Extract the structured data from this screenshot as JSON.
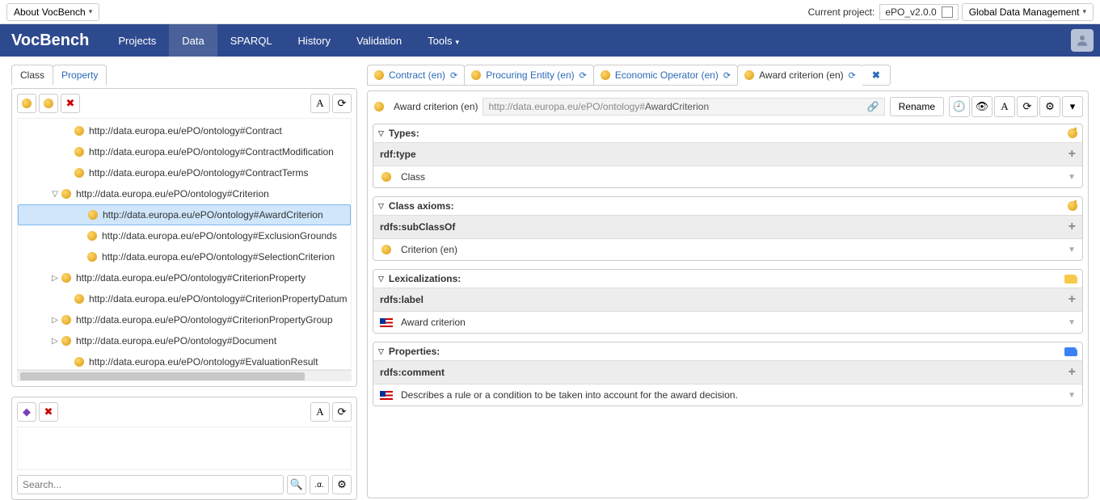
{
  "topbar": {
    "about": "About VocBench",
    "current_project_label": "Current project:",
    "current_project_value": "ePO_v2.0.0",
    "global_mgmt": "Global Data Management"
  },
  "nav": {
    "brand": "VocBench",
    "items": [
      "Projects",
      "Data",
      "SPARQL",
      "History",
      "Validation",
      "Tools"
    ],
    "active_index": 1
  },
  "left_tabs": {
    "class": "Class",
    "property": "Property"
  },
  "tree": {
    "items": [
      {
        "label": "http://data.europa.eu/ePO/ontology#Contract",
        "depth": 1,
        "exp": ""
      },
      {
        "label": "http://data.europa.eu/ePO/ontology#ContractModification",
        "depth": 1,
        "exp": ""
      },
      {
        "label": "http://data.europa.eu/ePO/ontology#ContractTerms",
        "depth": 1,
        "exp": ""
      },
      {
        "label": "http://data.europa.eu/ePO/ontology#Criterion",
        "depth": 0,
        "exp": "▽"
      },
      {
        "label": "http://data.europa.eu/ePO/ontology#AwardCriterion",
        "depth": 2,
        "exp": "",
        "selected": true
      },
      {
        "label": "http://data.europa.eu/ePO/ontology#ExclusionGrounds",
        "depth": 2,
        "exp": ""
      },
      {
        "label": "http://data.europa.eu/ePO/ontology#SelectionCriterion",
        "depth": 2,
        "exp": ""
      },
      {
        "label": "http://data.europa.eu/ePO/ontology#CriterionProperty",
        "depth": 0,
        "exp": "▷"
      },
      {
        "label": "http://data.europa.eu/ePO/ontology#CriterionPropertyDatum",
        "depth": 1,
        "exp": ""
      },
      {
        "label": "http://data.europa.eu/ePO/ontology#CriterionPropertyGroup",
        "depth": 0,
        "exp": "▷"
      },
      {
        "label": "http://data.europa.eu/ePO/ontology#Document",
        "depth": 0,
        "exp": "▷"
      },
      {
        "label": "http://data.europa.eu/ePO/ontology#EvaluationResult",
        "depth": 1,
        "exp": ""
      }
    ]
  },
  "search": {
    "placeholder": "Search..."
  },
  "rtabs": [
    {
      "label": "Contract (en)"
    },
    {
      "label": "Procuring Entity (en)"
    },
    {
      "label": "Economic Operator (en)"
    },
    {
      "label": "Award criterion (en)",
      "active": true
    }
  ],
  "resource": {
    "label": "Award criterion (en)",
    "uri_prefix": "http://data.europa.eu/ePO/ontology#",
    "uri_local": "AwardCriterion",
    "rename": "Rename"
  },
  "sections": {
    "types": {
      "title": "Types:",
      "prop": "rdf:type",
      "value": "Class"
    },
    "axioms": {
      "title": "Class axioms:",
      "prop": "rdfs:subClassOf",
      "value": "Criterion (en)"
    },
    "lex": {
      "title": "Lexicalizations:",
      "prop": "rdfs:label",
      "value": "Award criterion"
    },
    "props": {
      "title": "Properties:",
      "prop": "rdfs:comment",
      "value": "Describes a rule or a condition to be taken into account for the award decision."
    }
  }
}
